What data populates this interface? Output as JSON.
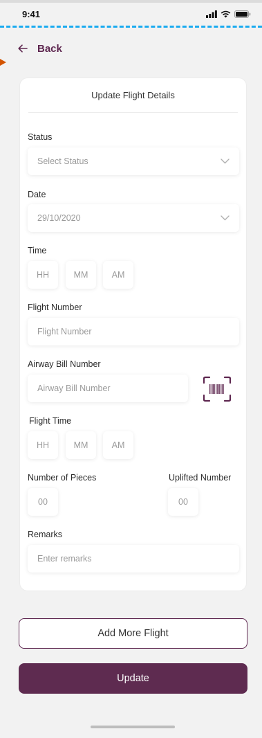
{
  "status_bar": {
    "time": "9:41"
  },
  "nav": {
    "back_label": "Back"
  },
  "form": {
    "title": "Update Flight Details",
    "status": {
      "label": "Status",
      "placeholder": "Select Status"
    },
    "date": {
      "label": "Date",
      "value": "29/10/2020"
    },
    "time": {
      "label": "Time",
      "hh": "HH",
      "mm": "MM",
      "ampm": "AM"
    },
    "flight_number": {
      "label": "Flight Number",
      "placeholder": "Flight Number"
    },
    "airway_bill": {
      "label": "Airway Bill Number",
      "placeholder": "Airway Bill Number"
    },
    "flight_time": {
      "label": "Flight Time",
      "hh": "HH",
      "mm": "MM",
      "ampm": "AM"
    },
    "pieces": {
      "label": "Number of Pieces",
      "placeholder": "00"
    },
    "uplifted": {
      "label": "Uplifted Number",
      "placeholder": "00"
    },
    "remarks": {
      "label": "Remarks",
      "placeholder": "Enter remarks"
    }
  },
  "actions": {
    "add_more_label": "Add More Flight",
    "update_label": "Update"
  },
  "colors": {
    "primary": "#5e2b50",
    "accent_dash": "#19aaf0",
    "background": "#f2f2f2"
  }
}
